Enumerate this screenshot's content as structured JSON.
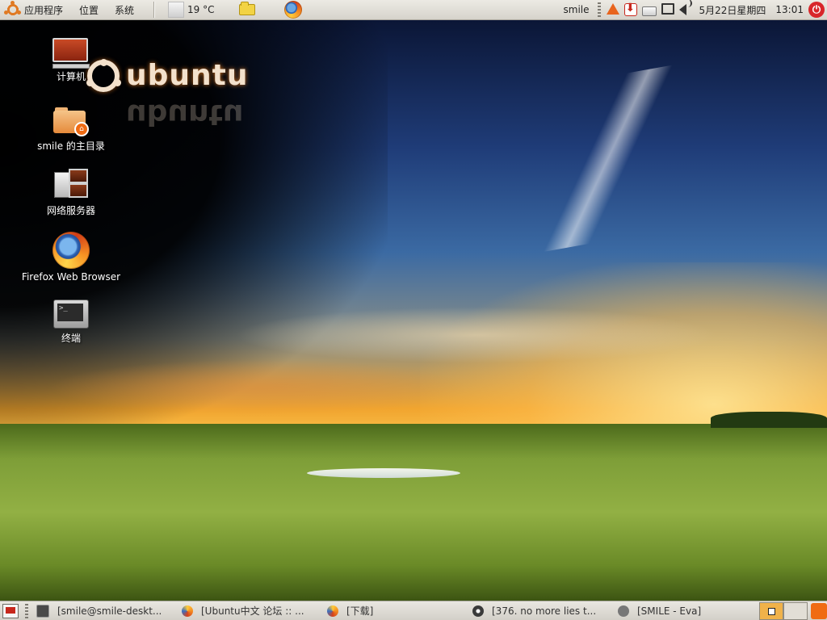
{
  "top_panel": {
    "menus": [
      "应用程序",
      "位置",
      "系统"
    ],
    "weather": "19 °C",
    "username": "smile",
    "datetime": "5月22日星期四",
    "time": "13:01"
  },
  "desktop": {
    "wallpaper_logo": "ubuntu",
    "icons": [
      {
        "label": "计算机",
        "icon": "computer-icon"
      },
      {
        "label": "smile 的主目录",
        "icon": "home-folder-icon"
      },
      {
        "label": "网络服务器",
        "icon": "network-servers-icon"
      },
      {
        "label": "Firefox Web Browser",
        "icon": "firefox-icon"
      },
      {
        "label": "终端",
        "icon": "terminal-icon"
      }
    ]
  },
  "taskbar": {
    "tasks": [
      {
        "label": "[smile@smile-deskt...",
        "icon": "terminal-icon"
      },
      {
        "label": "[Ubuntu中文 论坛 :: ...",
        "icon": "firefox-icon"
      },
      {
        "label": "[下载]",
        "icon": "firefox-icon"
      },
      {
        "label": "[376. no more lies t...",
        "icon": "music-player-icon"
      },
      {
        "label": "[SMILE - Eva]",
        "icon": "eva-icon"
      }
    ]
  },
  "colors": {
    "panel_bg": "#dddad3",
    "accent_orange": "#e07a24",
    "workspace_active": "#f0b24a",
    "power_red": "#d8262a"
  }
}
